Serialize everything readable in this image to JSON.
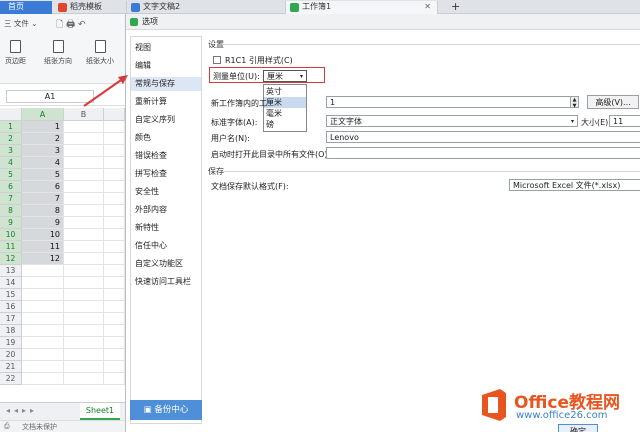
{
  "tabs": [
    {
      "label": "首页",
      "color": "#3b7bd6"
    },
    {
      "label": "稻壳模板",
      "color": "#e0452f"
    },
    {
      "label": "文字文稿2",
      "color": "#3b7bd6"
    },
    {
      "label": "工作簿1",
      "color": "#2fa84f"
    }
  ],
  "ribbon": {
    "file_menu": "三 文件",
    "btn_margin": "页边距",
    "btn_orientation": "纸张方向",
    "btn_size": "纸张大小"
  },
  "formula": {
    "namebox": "A1"
  },
  "grid": {
    "columns": [
      "A",
      "B"
    ],
    "rows": [
      "1",
      "2",
      "3",
      "4",
      "5",
      "6",
      "7",
      "8",
      "9",
      "10",
      "11",
      "12"
    ],
    "values": [
      "1",
      "2",
      "3",
      "4",
      "5",
      "6",
      "7",
      "8",
      "9",
      "10",
      "11",
      "12"
    ]
  },
  "sheet": {
    "tab": "Sheet1",
    "status": "文档未保护"
  },
  "dialog": {
    "title": "选项",
    "nav": [
      "视图",
      "编辑",
      "常规与保存",
      "重新计算",
      "自定义序列",
      "颜色",
      "错误检查",
      "拼写检查",
      "安全性",
      "外部内容",
      "新特性",
      "信任中心",
      "自定义功能区",
      "快速访问工具栏"
    ],
    "nav_selected": "常规与保存",
    "backup": "备份中心",
    "section_settings": "设置",
    "r1c1": "R1C1 引用样式(C)",
    "unit_label": "测量单位(U):",
    "unit_value": "厘米",
    "unit_options": [
      "英寸",
      "厘米",
      "毫米",
      "磅"
    ],
    "unit_option_selected": "厘米",
    "new_wb_label": "新工作簿内的工",
    "new_wb_value": "1",
    "advanced": "高级(V)...",
    "font_label": "标准字体(A):",
    "font_value": "正文字体",
    "size_label": "大小(E):",
    "size_value": "11",
    "user_label": "用户名(N):",
    "user_value": "Lenovo",
    "startup_label": "启动时打开此目录中所有文件(O):",
    "section_save": "保存",
    "save_format_label": "文档保存默认格式(F):",
    "save_format_value": "Microsoft Excel 文件(*.xlsx)",
    "ok_button": "确定"
  },
  "watermark": {
    "brand": "Office教程网",
    "url": "www.office26.com"
  },
  "colors": {
    "accent": "#4f8fd8",
    "highlight": "#d63a3a",
    "selection": "#d6d9dc"
  }
}
